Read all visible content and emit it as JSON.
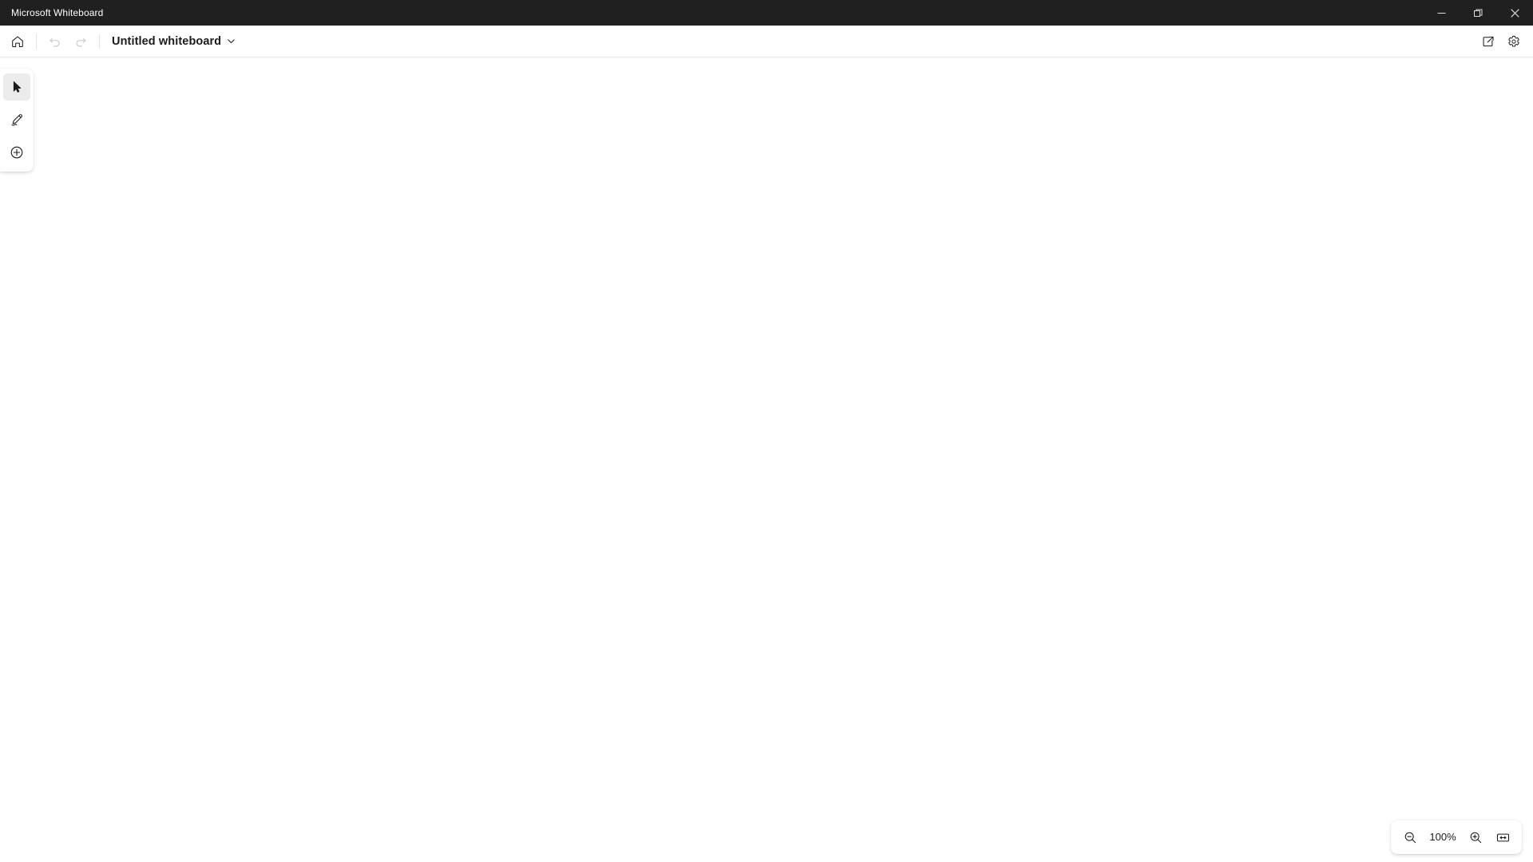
{
  "window": {
    "app_title": "Microsoft Whiteboard",
    "controls": {
      "minimize_label": "Minimize",
      "maximize_label": "Restore",
      "close_label": "Close"
    }
  },
  "header": {
    "home_label": "Home",
    "undo_label": "Undo",
    "redo_label": "Redo",
    "document_title": "Untitled whiteboard",
    "title_menu_label": "Whiteboard options",
    "share_label": "Share",
    "settings_label": "Settings"
  },
  "toolbar": {
    "tools": [
      {
        "id": "select",
        "label": "Select",
        "icon": "cursor-icon",
        "selected": true
      },
      {
        "id": "ink",
        "label": "Ink",
        "icon": "pen-icon",
        "selected": false
      },
      {
        "id": "create",
        "label": "Create",
        "icon": "plus-circle-icon",
        "selected": false
      }
    ]
  },
  "zoom": {
    "zoom_out_label": "Zoom out",
    "level": "100%",
    "zoom_in_label": "Zoom in",
    "fit_label": "Fit to screen"
  },
  "canvas": {
    "background_color": "#ffffff",
    "content": ""
  },
  "colors": {
    "titlebar_bg": "#202020",
    "titlebar_text": "#ffffff",
    "header_bg": "#ffffff",
    "text_primary": "#1b1b1b",
    "text_disabled": "#c7c7c7",
    "selected_tool_bg": "#ebebeb",
    "divider": "#e0e0e0"
  }
}
